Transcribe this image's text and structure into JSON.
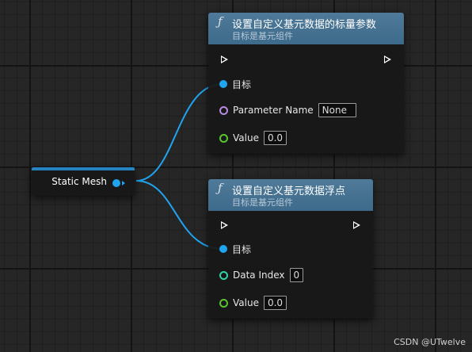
{
  "static_mesh_node": {
    "label": "Static Mesh"
  },
  "node_scalar": {
    "icon": "function-icon",
    "title": "设置自定义基元数据的标量参数",
    "subtitle": "目标是基元组件",
    "target_label": "目标",
    "param_name_label": "Parameter Name",
    "param_name_value": "None",
    "value_label": "Value",
    "value_value": "0.0"
  },
  "node_float": {
    "icon": "function-icon",
    "title": "设置自定义基元数据浮点",
    "subtitle": "目标是基元组件",
    "target_label": "目标",
    "data_index_label": "Data Index",
    "data_index_value": "0",
    "value_label": "Value",
    "value_value": "0.0"
  },
  "watermark": "CSDN @UTwelve",
  "colors": {
    "header": "#3e6a8b",
    "object_pin": "#21a4ef",
    "name_pin": "#b68be0",
    "float_pin": "#58c72e",
    "int_pin": "#2fd4a6"
  }
}
